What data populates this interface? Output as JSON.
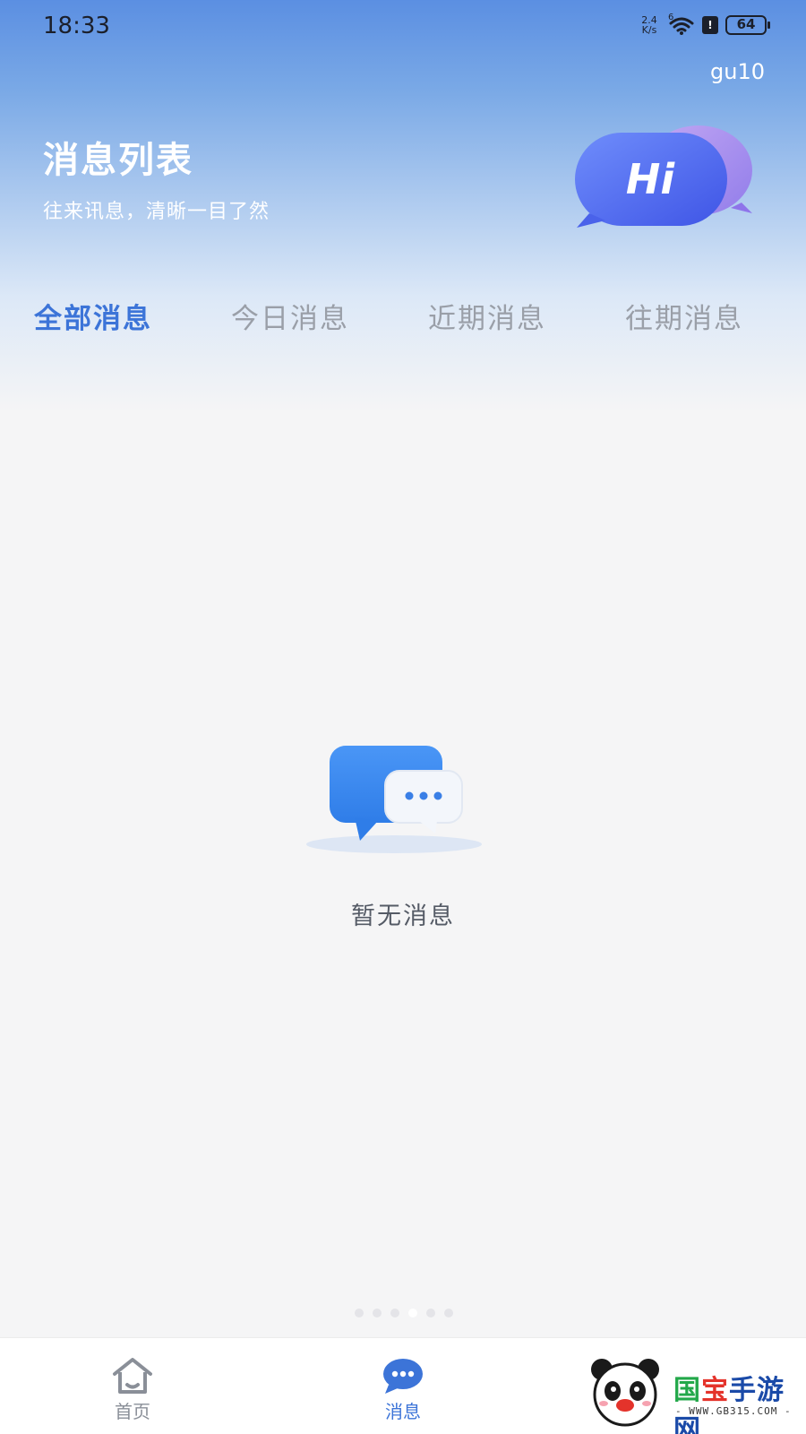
{
  "status_bar": {
    "time": "18:33",
    "net_speed_value": "2.4",
    "net_speed_unit": "K/s",
    "wifi_label": "6",
    "battery": "64",
    "sim_label": "!"
  },
  "header": {
    "user": "gu10",
    "title": "消息列表",
    "subtitle": "往来讯息，清晰一目了然",
    "badge_text": "Hi"
  },
  "tabs": [
    {
      "label": "全部消息",
      "active": true
    },
    {
      "label": "今日消息",
      "active": false
    },
    {
      "label": "近期消息",
      "active": false
    },
    {
      "label": "往期消息",
      "active": false
    }
  ],
  "empty_state": {
    "message": "暂无消息",
    "icon": "chat-bubbles-icon"
  },
  "bottom_nav": [
    {
      "label": "首页",
      "icon": "home-icon",
      "active": false
    },
    {
      "label": "消息",
      "icon": "message-icon",
      "active": true
    }
  ],
  "watermark": {
    "brand_1": "国",
    "brand_2": "宝",
    "brand_3": "手游网",
    "url": "- WWW.GB315.COM -"
  },
  "colors": {
    "accent": "#3c74d8",
    "inactive_tab": "#9a9fa8",
    "header_top": "#5b8fe2",
    "background": "#f5f5f6"
  }
}
